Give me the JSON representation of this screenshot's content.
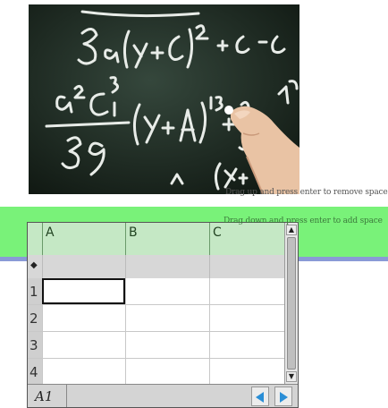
{
  "hints": {
    "remove_space": "Drag up and press enter to remove space",
    "add_space": "Drag down and press enter to add space"
  },
  "spreadsheet": {
    "columns": [
      "A",
      "B",
      "C"
    ],
    "formula_row_marker": "◆",
    "rows": [
      "1",
      "2",
      "3",
      "4"
    ],
    "selected_cell_ref": "A1",
    "scroll_up_icon": "triangle-up-icon",
    "scroll_down_icon": "triangle-down-icon",
    "nav_prev_icon": "triangle-left-icon",
    "nav_next_icon": "triangle-right-icon"
  },
  "colors": {
    "drag_band": "#79f279",
    "band_line": "#8a9ad6",
    "nav_arrows": "#2a8ed6"
  }
}
